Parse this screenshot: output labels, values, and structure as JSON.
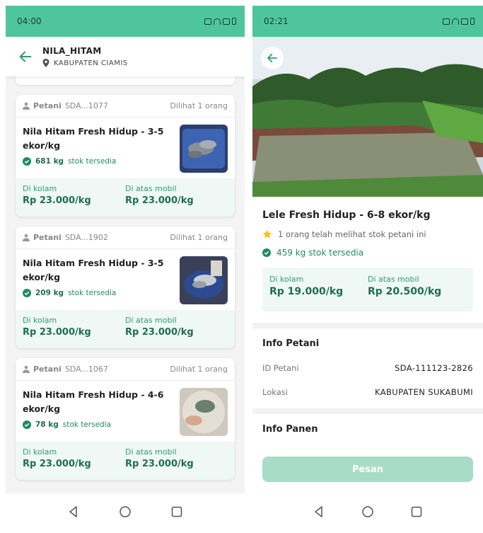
{
  "colors": {
    "accent": "#4fc59e",
    "price_text": "#1f6e52",
    "price_bg": "#eff8f4",
    "order_button": "#a8dcc7"
  },
  "left": {
    "status_time": "04:00",
    "appbar": {
      "title": "NILA_HITAM",
      "location": "KABUPATEN CIAMIS"
    },
    "cards": [
      {
        "farmer_label": "Petani",
        "farmer_id": "SDA...1077",
        "viewed": "Dilihat 1 orang",
        "title": "Nila Hitam Fresh Hidup - 3-5 ekor/kg",
        "stock_qty": "681 kg",
        "stock_text": "stok tersedia",
        "pond_label": "Di kolam",
        "pond_price": "Rp 23.000/kg",
        "car_label": "Di atas mobil",
        "car_price": "Rp 23.000/kg"
      },
      {
        "farmer_label": "Petani",
        "farmer_id": "SDA...1902",
        "viewed": "Dilihat 1 orang",
        "title": "Nila Hitam Fresh Hidup - 3-5 ekor/kg",
        "stock_qty": "209 kg",
        "stock_text": "stok tersedia",
        "pond_label": "Di kolam",
        "pond_price": "Rp 23.000/kg",
        "car_label": "Di atas mobil",
        "car_price": "Rp 23.000/kg"
      },
      {
        "farmer_label": "Petani",
        "farmer_id": "SDA...1067",
        "viewed": "Dilihat 1 orang",
        "title": "Nila Hitam Fresh Hidup - 4-6 ekor/kg",
        "stock_qty": "78 kg",
        "stock_text": "stok tersedia",
        "pond_label": "Di kolam",
        "pond_price": "Rp 23.000/kg",
        "car_label": "Di atas mobil",
        "car_price": "Rp 23.000/kg"
      }
    ]
  },
  "right": {
    "status_time": "02:21",
    "product_title": "Lele Fresh Hidup - 6-8 ekor/kg",
    "views_text": "1 orang telah melihat stok petani ini",
    "stock_text": "459 kg stok tersedia",
    "pond_label": "Di kolam",
    "pond_price": "Rp 19.000/kg",
    "car_label": "Di atas mobil",
    "car_price": "Rp 20.500/kg",
    "farmer_section": "Info Petani",
    "farmer_id_label": "ID Petani",
    "farmer_id_value": "SDA-111123-2826",
    "location_label": "Lokasi",
    "location_value": "KABUPATEN SUKABUMI",
    "harvest_section": "Info Panen",
    "order_button": "Pesan"
  }
}
